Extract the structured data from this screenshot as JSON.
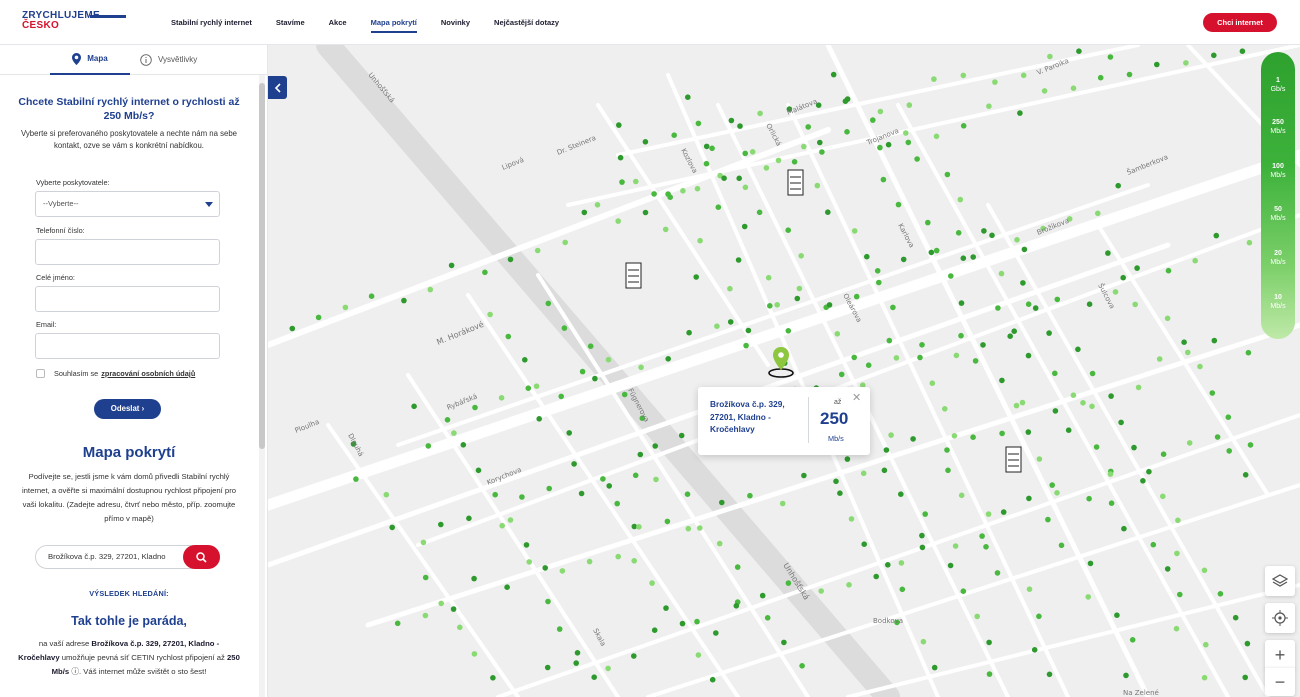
{
  "header": {
    "logo_line1": "ZRYCHLUJEME",
    "logo_line2": "ČESKO",
    "nav": [
      {
        "label": "Stabilní rychlý internet"
      },
      {
        "label": "Stavíme"
      },
      {
        "label": "Akce"
      },
      {
        "label": "Mapa pokrytí",
        "active": true
      },
      {
        "label": "Novinky"
      },
      {
        "label": "Nejčastější dotazy"
      }
    ],
    "cta": "Chci internet"
  },
  "sidebar": {
    "tabs": [
      {
        "label": "Mapa"
      },
      {
        "label": "Vysvětlivky"
      }
    ],
    "form": {
      "headline": "Chcete Stabilní rychlý internet o rychlosti až 250 Mb/s?",
      "subtitle": "Vyberte si preferovaného poskytovatele a nechte nám na sebe kontakt, ozve se vám s konkrétní nabídkou.",
      "provider_label": "Vyberte poskytovatele:",
      "provider_value": "--Vyberte--",
      "phone_label": "Telefonní číslo:",
      "name_label": "Celé jméno:",
      "email_label": "Email:",
      "consent_text": "Souhlasím se",
      "consent_link": "zpracování osobních údajů",
      "submit": "Odeslat"
    },
    "coverage": {
      "title": "Mapa pokrytí",
      "description": "Podívejte se, jestli jsme k vám domů přivedli Stabilní rychlý internet, a ověřte si maximální dostupnou rychlost připojení pro vaši lokalitu. (Zadejte adresu, čtvrť nebo město, příp. zoomujte přímo v mapě)",
      "search_value": "Brožíkova č.p. 329, 27201, Kladno"
    },
    "result": {
      "label": "VÝSLEDEK HLEDÁNÍ:",
      "title": "Tak tohle je paráda,",
      "text_prefix": "na vaší adrese",
      "address": "Brožíkova č.p. 329, 27201, Kladno - Kročehlavy",
      "text_mid": "umožňuje pevná síť CETIN rychlost připojení až",
      "speed": "250 Mb/s",
      "text_suffix": ". Váš internet může svištět o sto šest!"
    }
  },
  "map": {
    "streets": [
      "Unhošťská",
      "Malátova",
      "Trojanova",
      "V. Paroika",
      "Lipová",
      "Dr. Steinera",
      "Kozlova",
      "Orlická",
      "Šamberkova",
      "Brožíkova",
      "Karlova",
      "Šulcova",
      "M. Horákové",
      "Rybářská",
      "Korychova",
      "Ploulha",
      "Oleárova",
      "Plzeňská",
      "Bodkova",
      "Na Zelené",
      "Unhošťská",
      "Fügnerova",
      "Dlouhá",
      "Skala"
    ],
    "popup": {
      "address": "Brožíkova č.p. 329, 27201, Kladno - Kročehlavy",
      "prefix": "až",
      "speed": "250",
      "unit": "Mb/s"
    },
    "legend": [
      {
        "value": "1",
        "unit": "Gb/s"
      },
      {
        "value": "250",
        "unit": "Mb/s"
      },
      {
        "value": "100",
        "unit": "Mb/s"
      },
      {
        "value": "50",
        "unit": "Mb/s"
      },
      {
        "value": "20",
        "unit": "Mb/s"
      },
      {
        "value": "10",
        "unit": "Mb/s"
      }
    ],
    "colors": {
      "dot_dark": "#2e9a2e",
      "dot_mid": "#49b83f",
      "dot_light": "#8ada74",
      "pin": "#8dc63f"
    }
  }
}
